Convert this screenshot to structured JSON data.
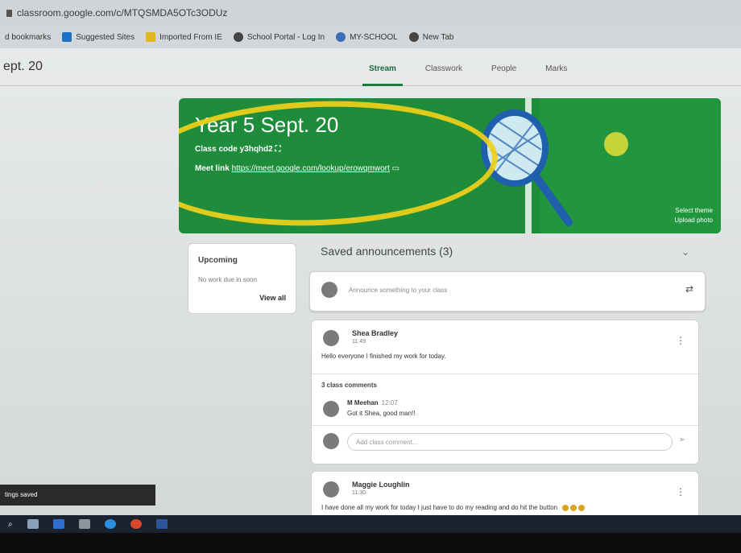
{
  "browser": {
    "url": "classroom.google.com/c/MTQSMDA5OTc3ODUz",
    "bookmarks": [
      "d bookmarks",
      "Suggested Sites",
      "Imported From IE",
      "School Portal - Log In",
      "MY-SCHOOL",
      "New Tab"
    ]
  },
  "header": {
    "class_name": "ept. 20",
    "tabs": [
      "Stream",
      "Classwork",
      "People",
      "Marks"
    ]
  },
  "banner": {
    "title": "Year 5 Sept. 20",
    "class_code_label": "Class code",
    "class_code": "y3hqhd2",
    "meet_label": "Meet link",
    "meet_link": "https://meet.google.com/lookup/erowqmwort",
    "select_theme": "Select theme",
    "upload_photo": "Upload photo"
  },
  "upcoming": {
    "title": "Upcoming",
    "text": "No work due in soon",
    "view_all": "View all"
  },
  "stream": {
    "saved_announcements": "Saved announcements (3)",
    "announce_placeholder": "Announce something to your class",
    "posts": [
      {
        "author": "Shea Bradley",
        "time": "11:49",
        "text": "Hello everyone I finished my work for today.",
        "comments_label": "3 class comments",
        "comment": {
          "author": "M Meehan",
          "time": "12:07",
          "text": "Got it Shea, good man!!"
        },
        "comment_placeholder": "Add class comment..."
      },
      {
        "author": "Maggie Loughlin",
        "time": "11:30",
        "text": "I have done all my work for today I just have to do my reading and do hit the button"
      }
    ]
  },
  "toast": "tings saved",
  "colors": {
    "banner_green": "#1e8c3a",
    "highlight_yellow": "#f0d01a",
    "accent_green": "#166f3a"
  }
}
